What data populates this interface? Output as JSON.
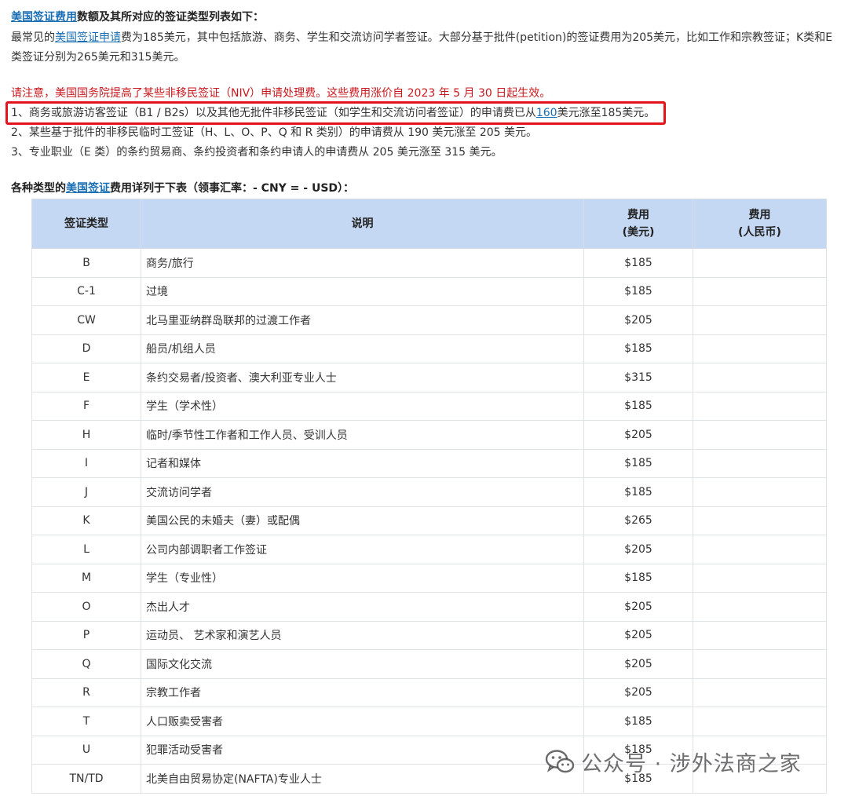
{
  "intro": {
    "heading_link": "美国签证费用",
    "heading_rest": "数额及其所对应的签证类型列表如下：",
    "p1_pre": "最常见的",
    "p1_link1": "美国签证",
    "p1_link2": "申请",
    "p1_post": "费为185美元，其中包括旅游、商务、学生和交流访问学者签证。大部分基于批件(petition)的签证费用为205美元，比如工作和宗教签证；K类和E",
    "p1_line2": "类签证分别为265美元和315美元。"
  },
  "notice": {
    "red_line": "请注意，美国国务院提高了某些非移民签证（NIV）申请处理费。这些费用涨价自 2023 年 5 月 30 日起生效。",
    "item1_pre": "1、商务或旅游访客签证（B1 / B2s）以及其他无批件非移民签证（如学生和交流访问者签证）的申请费已从",
    "item1_link": "160",
    "item1_post": "美元涨至185美元。",
    "item2": "2、某些基于批件的非移民临时工签证（H、L、O、P、Q 和 R 类别）的申请费从 190 美元涨至 205 美元。",
    "item3": "3、专业职业（E 类）的条约贸易商、条约投资者和条约申请人的申请费从 205 美元涨至 315 美元。"
  },
  "table_title": {
    "pre": "各种类型的",
    "link": "美国签证",
    "post": "费用详列于下表（领事汇率：- CNY = - USD）："
  },
  "table": {
    "headers": {
      "type": "签证类型",
      "desc": "说明",
      "usd_l1": "费用",
      "usd_l2": "(美元)",
      "rmb_l1": "费用",
      "rmb_l2": "(人民币)"
    },
    "rows": [
      {
        "type": "B",
        "desc": "商务/旅行",
        "usd": "$185",
        "rmb": ""
      },
      {
        "type": "C-1",
        "desc": "过境",
        "usd": "$185",
        "rmb": ""
      },
      {
        "type": "CW",
        "desc": "北马里亚纳群岛联邦的过渡工作者",
        "usd": "$205",
        "rmb": ""
      },
      {
        "type": "D",
        "desc": "船员/机组人员",
        "usd": "$185",
        "rmb": ""
      },
      {
        "type": "E",
        "desc": "条约交易者/投资者、澳大利亚专业人士",
        "usd": "$315",
        "rmb": ""
      },
      {
        "type": "F",
        "desc": "学生（学术性）",
        "usd": "$185",
        "rmb": ""
      },
      {
        "type": "H",
        "desc": "临时/季节性工作者和工作人员、受训人员",
        "usd": "$205",
        "rmb": ""
      },
      {
        "type": "I",
        "desc": "记者和媒体",
        "usd": "$185",
        "rmb": ""
      },
      {
        "type": "J",
        "desc": "交流访问学者",
        "usd": "$185",
        "rmb": ""
      },
      {
        "type": "K",
        "desc": "美国公民的未婚夫（妻）或配偶",
        "usd": "$265",
        "rmb": ""
      },
      {
        "type": "L",
        "desc": "公司内部调职者工作签证",
        "usd": "$205",
        "rmb": ""
      },
      {
        "type": "M",
        "desc": "学生（专业性）",
        "usd": "$185",
        "rmb": ""
      },
      {
        "type": "O",
        "desc": "杰出人才",
        "usd": "$205",
        "rmb": ""
      },
      {
        "type": "P",
        "desc": "运动员、 艺术家和演艺人员",
        "usd": "$205",
        "rmb": ""
      },
      {
        "type": "Q",
        "desc": "国际文化交流",
        "usd": "$205",
        "rmb": ""
      },
      {
        "type": "R",
        "desc": "宗教工作者",
        "usd": "$205",
        "rmb": ""
      },
      {
        "type": "T",
        "desc": "人口贩卖受害者",
        "usd": "$185",
        "rmb": ""
      },
      {
        "type": "U",
        "desc": "犯罪活动受害者",
        "usd": "$185",
        "rmb": ""
      },
      {
        "type": "TN/TD",
        "desc": "北美自由贸易协定(NAFTA)专业人士",
        "usd": "$185",
        "rmb": ""
      }
    ]
  },
  "watermark": {
    "icon": "wechat-icon",
    "text": "公众号 · 涉外法商之家"
  },
  "colors": {
    "link": "#1a6fb4",
    "notice_red": "#c8181e",
    "highlight_border": "#e3141b",
    "table_header_bg": "#c5d8f3"
  }
}
